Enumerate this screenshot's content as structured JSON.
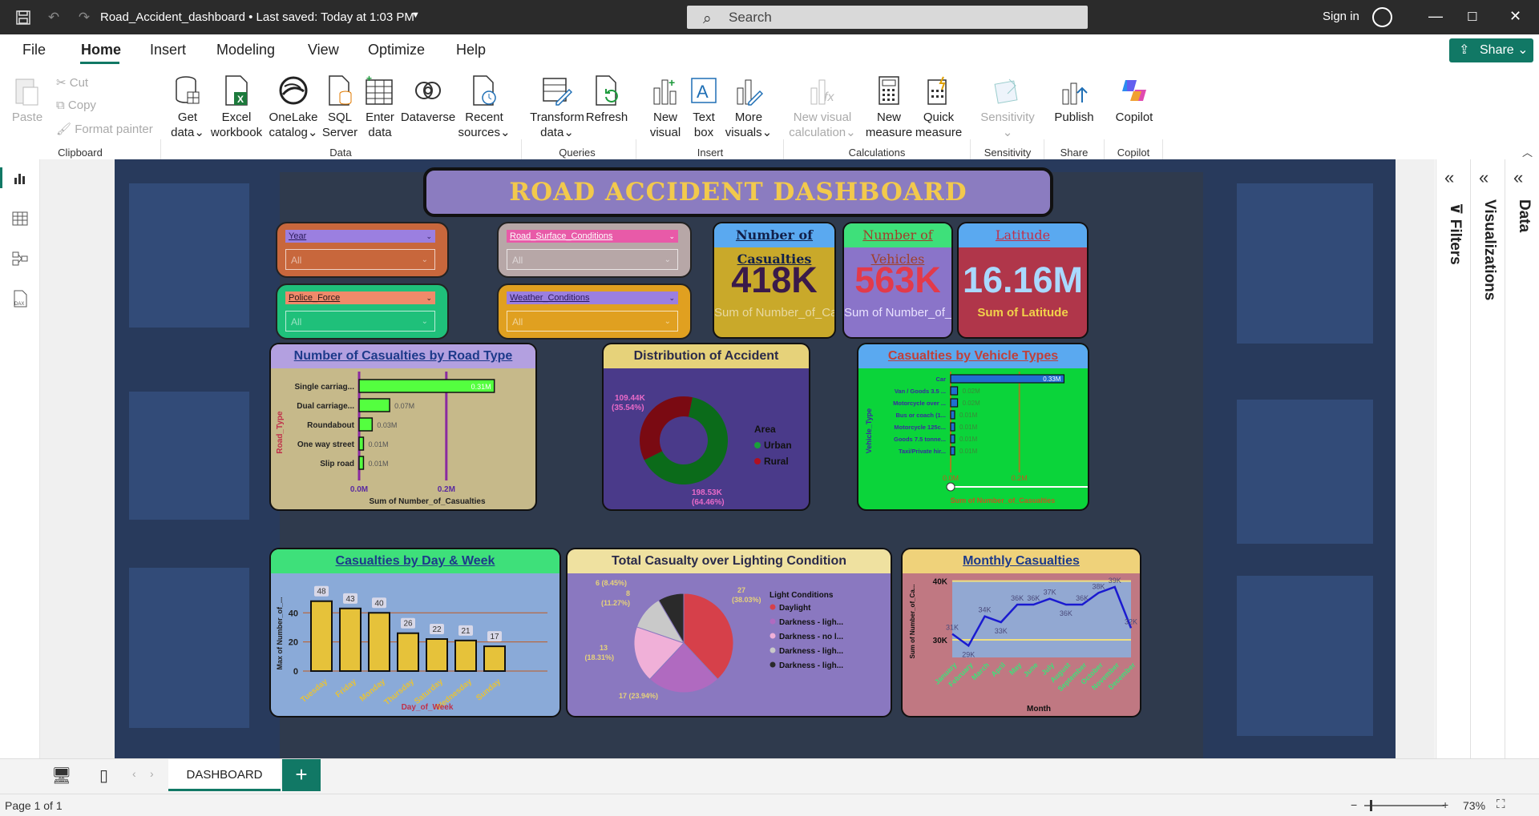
{
  "titlebar": {
    "doc_title": "Road_Accident_dashboard • Last saved: Today at 1:03 PM",
    "search_placeholder": "Search",
    "signin": "Sign in"
  },
  "menu": {
    "items": [
      "File",
      "Home",
      "Insert",
      "Modeling",
      "View",
      "Optimize",
      "Help"
    ],
    "active": "Home",
    "share_label": "Share"
  },
  "ribbon": {
    "clipboard": {
      "paste": "Paste",
      "cut": "Cut",
      "copy": "Copy",
      "format_painter": "Format painter",
      "group": "Clipboard"
    },
    "data": {
      "buttons": [
        {
          "l1": "Get",
          "l2": "data"
        },
        {
          "l1": "Excel",
          "l2": "workbook"
        },
        {
          "l1": "OneLake",
          "l2": "catalog"
        },
        {
          "l1": "SQL",
          "l2": "Server"
        },
        {
          "l1": "Enter",
          "l2": "data"
        },
        {
          "l1": "Dataverse",
          "l2": ""
        },
        {
          "l1": "Recent",
          "l2": "sources"
        }
      ],
      "group": "Data"
    },
    "queries": {
      "transform_l1": "Transform",
      "transform_l2": "data",
      "refresh": "Refresh",
      "group": "Queries"
    },
    "insert": {
      "new_visual_l1": "New",
      "new_visual_l2": "visual",
      "text_box_l1": "Text",
      "text_box_l2": "box",
      "more_visuals_l1": "More",
      "more_visuals_l2": "visuals",
      "group": "Insert"
    },
    "calculations": {
      "new_visual_calc_l1": "New visual",
      "new_visual_calc_l2": "calculation",
      "new_measure_l1": "New",
      "new_measure_l2": "measure",
      "quick_measure_l1": "Quick",
      "quick_measure_l2": "measure",
      "group": "Calculations"
    },
    "sensitivity": {
      "label": "Sensitivity",
      "group": "Sensitivity"
    },
    "share": {
      "publish": "Publish",
      "group": "Share"
    },
    "copilot": {
      "label": "Copilot",
      "group": "Copilot"
    }
  },
  "dashboard": {
    "title": "ROAD ACCIDENT DASHBOARD",
    "slicers": [
      {
        "label": "Year",
        "value": "All",
        "bg": "#c8673c",
        "labelbg": "#9b7fe0"
      },
      {
        "label": "Road_Surface_Conditions",
        "value": "All",
        "bg": "#b7a7a7",
        "labelbg": "#e85aa8"
      },
      {
        "label": "Police_Force",
        "value": "All",
        "bg": "#1fc07a",
        "labelbg": "#f08a6a"
      },
      {
        "label": "Weather_Conditions",
        "value": "All",
        "bg": "#e0a020",
        "labelbg": "#9b7fe0"
      }
    ],
    "cards": [
      {
        "title": "Number of Casualties",
        "value": "418K",
        "sub": "Sum of Number_of_Casual...",
        "bg": "#c9a92a",
        "hdbg": "#5aa9f0",
        "valcolor": "#3a1a4a",
        "subcolor": "#e8d9a0"
      },
      {
        "title": "Number of Vehicles",
        "value": "563K",
        "sub": "Sum of Number_of_Ve...",
        "bg": "#8a74c9",
        "hdbg": "#3ee07a",
        "valcolor": "#e23a4a",
        "subcolor": "#e9e2ff"
      },
      {
        "title": "Latitude",
        "value": "16.16M",
        "sub": "Sum of Latitude",
        "bg": "#b0364a",
        "hdbg": "#5aa9f0",
        "valcolor": "#a9d9ff",
        "subcolor": "#f2d24a"
      }
    ],
    "road_type": {
      "title": "Number of Casualties by Road Type",
      "chart_data": {
        "type": "bar",
        "categories": [
          "Single carriag...",
          "Dual carriage...",
          "Roundabout",
          "One way street",
          "Slip road"
        ],
        "values": [
          0.31,
          0.07,
          0.03,
          0.01,
          0.01
        ],
        "value_labels": [
          "0.31M",
          "0.07M",
          "0.03M",
          "0.01M",
          "0.01M"
        ],
        "xticks": [
          "0.0M",
          "0.2M"
        ],
        "xlabel": "Sum of Number_of_Casualties",
        "ylabel": "Road_Type",
        "xlim": [
          0,
          0.34
        ]
      }
    },
    "distribution": {
      "title": "Distribution of Accident",
      "chart_data": {
        "type": "pie",
        "labels": [
          "Urban",
          "Rural"
        ],
        "values": [
          198.53,
          109.44
        ],
        "label_texts": [
          "198.53K (64.46%)",
          "109.44K (35.54%)"
        ],
        "legend_title": "Area",
        "colors": [
          "#0b6b1a",
          "#7a0a12"
        ]
      }
    },
    "vehicle_types": {
      "title": "Casualties by Vehicle Types",
      "chart_data": {
        "type": "bar",
        "categories": [
          "Car",
          "Van / Goods 3.5 ...",
          "Motorcycle over ...",
          "Bus or coach (1...",
          "Motorcycle 125c...",
          "Goods 7.5 tonne...",
          "Taxi/Private hir..."
        ],
        "values": [
          0.33,
          0.02,
          0.02,
          0.01,
          0.01,
          0.01,
          0.01
        ],
        "value_labels": [
          "0.33M",
          "0.02M",
          "0.02M",
          "0.01M",
          "0.01M",
          "0.01M",
          "0.01M"
        ],
        "xticks": [
          "0.0M",
          "0.2M"
        ],
        "xlabel": "Sum of Number_of_Casualties",
        "ylabel": "Vehicle_Type",
        "xlim": [
          0,
          0.35
        ]
      }
    },
    "day_week": {
      "title": "Casualties by Day & Week",
      "chart_data": {
        "type": "bar",
        "categories": [
          "Tuesday",
          "Friday",
          "Monday",
          "Thursday",
          "Saturday",
          "Wednesday",
          "Sunday"
        ],
        "values": [
          48,
          43,
          40,
          26,
          22,
          21,
          17
        ],
        "yticks": [
          "0",
          "20",
          "40"
        ],
        "ylim": [
          0,
          55
        ],
        "xlabel": "Day_of_Week",
        "ylabel": "Max of Number_of_..."
      }
    },
    "lighting": {
      "title": "Total Casualty over Lighting Condition",
      "chart_data": {
        "type": "pie",
        "legend_title": "Light Conditions",
        "labels": [
          "Daylight",
          "Darkness - ligh...",
          "Darkness - no l...",
          "Darkness - ligh...",
          "Darkness - ligh..."
        ],
        "values": [
          27,
          17,
          13,
          8,
          6
        ],
        "label_texts": [
          "27 (38.03%)",
          "17 (23.94%)",
          "13 (18.31%)",
          "8 (11.27%)",
          "6 (8.45%)"
        ],
        "colors": [
          "#d6404a",
          "#b06ac0",
          "#f0b0d8",
          "#c9c9c9",
          "#2a2a2a"
        ]
      }
    },
    "monthly": {
      "title": "Monthly Casualties",
      "chart_data": {
        "type": "line",
        "categories": [
          "January",
          "February",
          "March",
          "April",
          "May",
          "June",
          "July",
          "August",
          "September",
          "October",
          "November",
          "December"
        ],
        "values": [
          31,
          29,
          34,
          33,
          36,
          36,
          37,
          36,
          36,
          38,
          39,
          32
        ],
        "point_labels": [
          "31K",
          "29K",
          "34K",
          "33K",
          "36K",
          "36K",
          "37K",
          "36K",
          "36K",
          "38K",
          "39K",
          "32K"
        ],
        "yticks": [
          "30K",
          "40K"
        ],
        "ylim": [
          27,
          40.5
        ],
        "xlabel": "Month",
        "ylabel": "Sum of Number_of_Ca..."
      }
    }
  },
  "tabs": {
    "active": "DASHBOARD"
  },
  "status": {
    "page": "Page 1 of 1",
    "zoom": "73%"
  },
  "panes": {
    "filters": "Filters",
    "visualizations": "Visualizations",
    "data": "Data"
  }
}
